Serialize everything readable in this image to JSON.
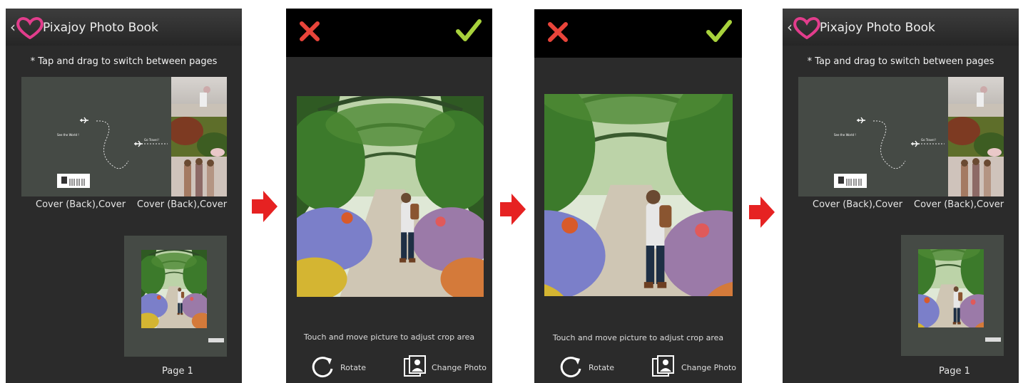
{
  "book": {
    "title": "Pixajoy Photo Book",
    "hint": "* Tap and drag to switch between pages",
    "cover_back_label": "Cover (Back),Cover",
    "cover_label": "Cover (Back),Cover",
    "cover_text_1": "See the World !",
    "cover_text_2": "Go Travel !",
    "page_label": "Page 1"
  },
  "crop": {
    "hint": "Touch and move picture to adjust crop area",
    "rotate_label": "Rotate",
    "change_label": "Change Photo"
  },
  "colors": {
    "close": "#e8443a",
    "confirm": "#a8d23c",
    "heart": "#e23d8c",
    "arrow": "#e62222"
  },
  "icons": [
    "back-chevron-icon",
    "heart-logo-icon",
    "airplane-icon",
    "barcode-icon",
    "close-icon",
    "check-icon",
    "rotate-icon",
    "change-photo-icon",
    "next-arrow-icon"
  ]
}
